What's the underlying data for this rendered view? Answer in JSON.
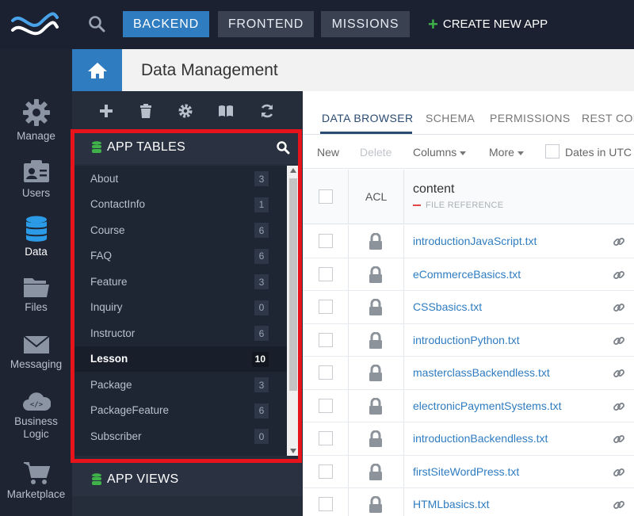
{
  "topbar": {
    "tabs": [
      {
        "label": "BACKEND",
        "active": true
      },
      {
        "label": "FRONTEND",
        "active": false
      },
      {
        "label": "MISSIONS",
        "active": false
      }
    ],
    "create_app_label": "CREATE NEW APP",
    "icons": {
      "logo": "wave-logo",
      "search": "search-icon"
    }
  },
  "leftnav": {
    "items": [
      {
        "label": "Manage",
        "icon": "gear-icon"
      },
      {
        "label": "Users",
        "icon": "user-card-icon"
      },
      {
        "label": "Data",
        "icon": "database-icon",
        "active": true
      },
      {
        "label": "Files",
        "icon": "folder-icon"
      },
      {
        "label": "Messaging",
        "icon": "envelope-icon"
      },
      {
        "label": "Business Logic",
        "icon": "cloud-code-icon"
      },
      {
        "label": "Marketplace",
        "icon": "cart-icon"
      }
    ]
  },
  "header": {
    "title": "Data Management",
    "home_icon": "home-icon"
  },
  "panel": {
    "toolbar_icons": [
      "plus-icon",
      "trash-icon",
      "gear-icon",
      "book-icon",
      "refresh-icon"
    ],
    "app_tables_label": "APP TABLES",
    "app_views_label": "APP VIEWS",
    "tables": [
      {
        "name": "About",
        "count": "3"
      },
      {
        "name": "ContactInfo",
        "count": "1"
      },
      {
        "name": "Course",
        "count": "6"
      },
      {
        "name": "FAQ",
        "count": "6"
      },
      {
        "name": "Feature",
        "count": "3"
      },
      {
        "name": "Inquiry",
        "count": "0"
      },
      {
        "name": "Instructor",
        "count": "6"
      },
      {
        "name": "Lesson",
        "count": "10",
        "active": true
      },
      {
        "name": "Package",
        "count": "3"
      },
      {
        "name": "PackageFeature",
        "count": "6"
      },
      {
        "name": "Subscriber",
        "count": "0"
      }
    ]
  },
  "main": {
    "subtabs": [
      "DATA BROWSER",
      "SCHEMA",
      "PERMISSIONS",
      "REST CON"
    ],
    "actions": {
      "new": "New",
      "delete": "Delete",
      "columns": "Columns",
      "more": "More",
      "dates_utc": "Dates in UTC"
    },
    "grid": {
      "acl_header": "ACL",
      "column_name": "content",
      "column_type": "FILE REFERENCE",
      "rows": [
        "introductionJavaScript.txt",
        "eCommerceBasics.txt",
        "CSSbasics.txt",
        "introductionPython.txt",
        "masterclassBackendless.txt",
        "electronicPaymentSystems.txt",
        "introductionBackendless.txt",
        "firstSiteWordPress.txt",
        "HTMLbasics.txt"
      ]
    }
  },
  "colors": {
    "accent_blue": "#2f7cc0",
    "highlight_red": "#e8141c",
    "db_green": "#3fb24a",
    "data_nav_blue": "#2b9be8"
  }
}
